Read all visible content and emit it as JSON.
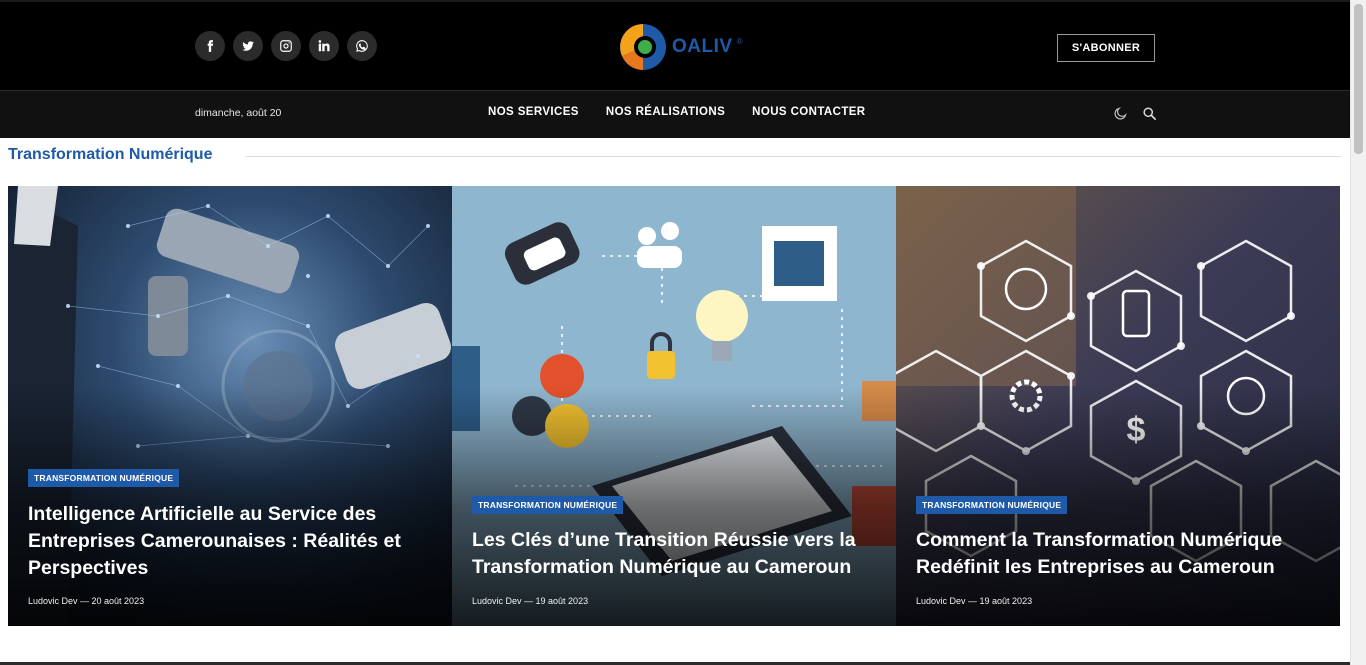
{
  "header": {
    "logo_text": "OALIV",
    "logo_mark": "®",
    "subscribe_label": "S'ABONNER",
    "socials": [
      "facebook-icon",
      "twitter-icon",
      "instagram-icon",
      "linkedin-icon",
      "whatsapp-icon"
    ]
  },
  "navbar": {
    "date": "dimanche, août 20",
    "items": [
      {
        "label": "NOS SERVICES"
      },
      {
        "label": "NOS RÉALISATIONS"
      },
      {
        "label": "NOUS CONTACTER"
      }
    ],
    "icons": [
      "moon-icon",
      "search-icon"
    ]
  },
  "section": {
    "title": "Transformation Numérique"
  },
  "cards": [
    {
      "category": "TRANSFORMATION NUMÉRIQUE",
      "title": "Intelligence Artificielle au Service des Entreprises Camerounaises : Réalités et Perspectives",
      "author": "Ludovic Dev",
      "date": "20 août 2023",
      "meta": "Ludovic Dev — 20 août 2023"
    },
    {
      "category": "TRANSFORMATION NUMÉRIQUE",
      "title": "Les Clés d’une Transition Réussie vers la Transformation Numérique au Cameroun",
      "author": "Ludovic Dev",
      "date": "19 août 2023",
      "meta": "Ludovic Dev — 19 août 2023"
    },
    {
      "category": "TRANSFORMATION NUMÉRIQUE",
      "title": "Comment la Transformation Numérique Redéfinit les Entreprises au Cameroun",
      "author": "Ludovic Dev",
      "date": "19 août 2023",
      "meta": "Ludovic Dev — 19 août 2023"
    }
  ],
  "colors": {
    "accent": "#1e5aa8",
    "header_bg": "#000000",
    "nav_bg": "#111111"
  }
}
